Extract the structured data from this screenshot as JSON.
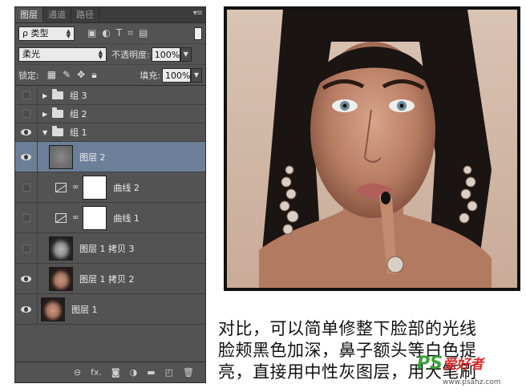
{
  "panel": {
    "tabs": [
      {
        "label": "图层",
        "active": true
      },
      {
        "label": "通道",
        "active": false
      },
      {
        "label": "路径",
        "active": false
      }
    ],
    "menu_icon": "panel-menu-icon",
    "filter": {
      "kind_label": "ρ 类型"
    },
    "blend": {
      "mode": "柔光",
      "opacity_label": "不透明度:",
      "opacity_value": "100%"
    },
    "lock": {
      "label": "锁定:",
      "fill_label": "填充:",
      "fill_value": "100%"
    },
    "layers": [
      {
        "name": "组 3",
        "type": "group",
        "visible": false,
        "expanded": false
      },
      {
        "name": "组 2",
        "type": "group",
        "visible": false,
        "expanded": false
      },
      {
        "name": "组 1",
        "type": "group",
        "visible": true,
        "expanded": true
      },
      {
        "name": "图层 2",
        "type": "pixel",
        "visible": true,
        "selected": true,
        "thumb": "gray"
      },
      {
        "name": "曲线 2",
        "type": "adjustment",
        "visible": false
      },
      {
        "name": "曲线 1",
        "type": "adjustment",
        "visible": false
      },
      {
        "name": "图层 1 拷贝 3",
        "type": "pixel",
        "visible": false,
        "thumb": "face-gray"
      },
      {
        "name": "图层 1 拷贝 2",
        "type": "pixel",
        "visible": true,
        "thumb": "face"
      },
      {
        "name": "图层 1",
        "type": "pixel",
        "visible": true,
        "thumb": "face"
      }
    ],
    "bottom_icons": [
      "link-icon",
      "fx-icon",
      "mask-icon",
      "adjustment-icon",
      "folder-icon",
      "new-layer-icon",
      "trash-icon"
    ],
    "fx_label": "fx."
  },
  "caption": {
    "lines": [
      "对比，可以简单修整下脸部的光线",
      "脸颊黑色加深，鼻子额头等白色提",
      "亮，直接用中性灰图层，用大笔刷"
    ]
  },
  "watermark": {
    "ps": "PS",
    "zh": "爱好者",
    "url": "www.psahz.com"
  },
  "colors": {
    "panel_bg": "#535353",
    "selected_row": "#6c7f98",
    "caption_text": "#111111"
  }
}
